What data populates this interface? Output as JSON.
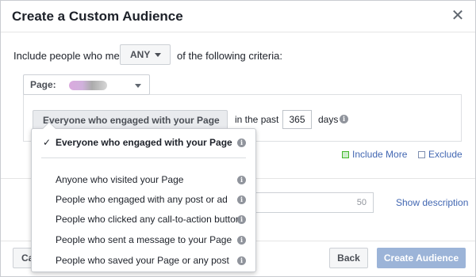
{
  "dialog": {
    "title": "Create a Custom Audience",
    "close_icon": "close-icon"
  },
  "criteria": {
    "prefix": "Include people who meet",
    "match": "ANY",
    "suffix": "of the following criteria:"
  },
  "page_select": {
    "label": "Page:"
  },
  "engagement": {
    "selected": "Everyone who engaged with your Page",
    "in_the_past": "in the past",
    "days_value": "365",
    "days_label": "days"
  },
  "links": {
    "include_more": "Include More",
    "exclude": "Exclude",
    "show_description": "Show description"
  },
  "name_field": {
    "char_count": "50"
  },
  "footer": {
    "cancel": "Cancel",
    "back": "Back",
    "create": "Create Audience"
  },
  "dropdown": {
    "items": [
      {
        "label": "Everyone who engaged with your Page",
        "selected": true
      },
      {
        "label": "Anyone who visited your Page",
        "selected": false
      },
      {
        "label": "People who engaged with any post or ad",
        "selected": false
      },
      {
        "label": "People who clicked any call-to-action button",
        "selected": false
      },
      {
        "label": "People who sent a message to your Page",
        "selected": false
      },
      {
        "label": "People who saved your Page or any post",
        "selected": false
      }
    ]
  },
  "colors": {
    "link": "#4267b2",
    "create_disabled": "#9cb4d8"
  }
}
